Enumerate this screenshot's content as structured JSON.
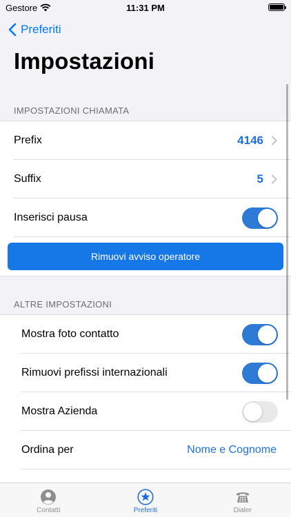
{
  "status_bar": {
    "carrier": "Gestore",
    "time": "11:31 PM"
  },
  "nav": {
    "back_label": "Preferiti",
    "title": "Impostazioni"
  },
  "section_call": {
    "header": "IMPOSTAZIONI CHIAMATA",
    "prefix": {
      "label": "Prefix",
      "value": "4146"
    },
    "suffix": {
      "label": "Suffix",
      "value": "5"
    },
    "pause": {
      "label": "Inserisci pausa",
      "on": true
    },
    "remove_button": "Rimuovi avviso operatore"
  },
  "section_other": {
    "header": "ALTRE IMPOSTAZIONI",
    "show_photo": {
      "label": "Mostra foto contatto",
      "on": true
    },
    "remove_prefixes": {
      "label": "Rimuovi prefissi internazionali",
      "on": true
    },
    "show_company": {
      "label": "Mostra Azienda",
      "on": false
    },
    "sort_by": {
      "label": "Ordina per",
      "value": "Nome e Cognome"
    }
  },
  "tab_bar": {
    "tabs": [
      {
        "label": "Contatti",
        "icon": "person-circle-icon",
        "active": false
      },
      {
        "label": "Preferiti",
        "icon": "star-circle-icon",
        "active": true
      },
      {
        "label": "Dialer",
        "icon": "phone-keypad-icon",
        "active": false
      }
    ]
  },
  "colors": {
    "accent": "#1e6fd9",
    "toggle_on": "#2e7bd6",
    "button": "#1677e6",
    "background": "#f2f2f7"
  }
}
